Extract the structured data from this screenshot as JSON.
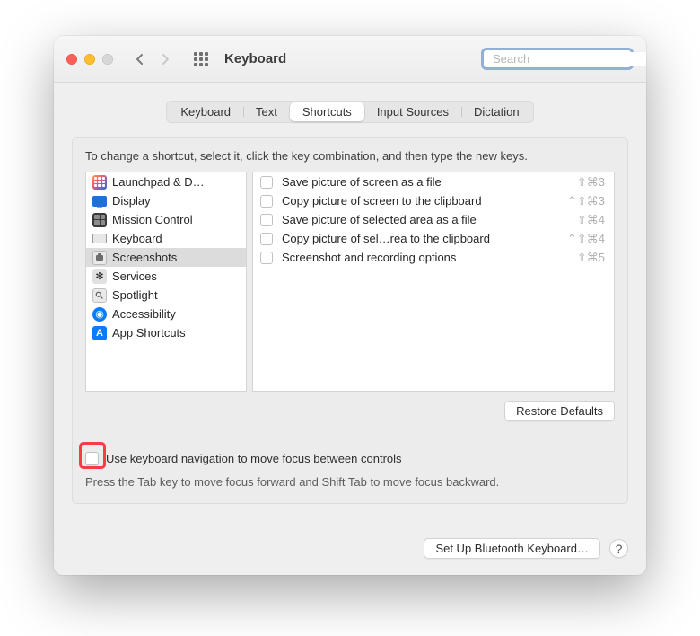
{
  "window": {
    "title": "Keyboard",
    "search_placeholder": "Search"
  },
  "tabs": [
    {
      "label": "Keyboard"
    },
    {
      "label": "Text"
    },
    {
      "label": "Shortcuts"
    },
    {
      "label": "Input Sources"
    },
    {
      "label": "Dictation"
    }
  ],
  "active_tab": "Shortcuts",
  "instruction": "To change a shortcut, select it, click the key combination, and then type the new keys.",
  "categories": [
    {
      "label": "Launchpad & D…",
      "icon": "launchpad"
    },
    {
      "label": "Display",
      "icon": "display"
    },
    {
      "label": "Mission Control",
      "icon": "mission"
    },
    {
      "label": "Keyboard",
      "icon": "keyboard"
    },
    {
      "label": "Screenshots",
      "icon": "screenshot",
      "selected": true
    },
    {
      "label": "Services",
      "icon": "gear"
    },
    {
      "label": "Spotlight",
      "icon": "spotlight"
    },
    {
      "label": "Accessibility",
      "icon": "accessibility"
    },
    {
      "label": "App Shortcuts",
      "icon": "appshortcuts"
    }
  ],
  "shortcuts": [
    {
      "label": "Save picture of screen as a file",
      "keys": "⇧⌘3"
    },
    {
      "label": "Copy picture of screen to the clipboard",
      "keys": "⌃⇧⌘3"
    },
    {
      "label": "Save picture of selected area as a file",
      "keys": "⇧⌘4"
    },
    {
      "label": "Copy picture of sel…rea to the clipboard",
      "keys": "⌃⇧⌘4"
    },
    {
      "label": "Screenshot and recording options",
      "keys": "⇧⌘5"
    }
  ],
  "buttons": {
    "restore": "Restore Defaults",
    "bluetooth": "Set Up Bluetooth Keyboard…"
  },
  "kbnav": {
    "label": "Use keyboard navigation to move focus between controls",
    "sub": "Press the Tab key to move focus forward and Shift Tab to move focus backward."
  }
}
